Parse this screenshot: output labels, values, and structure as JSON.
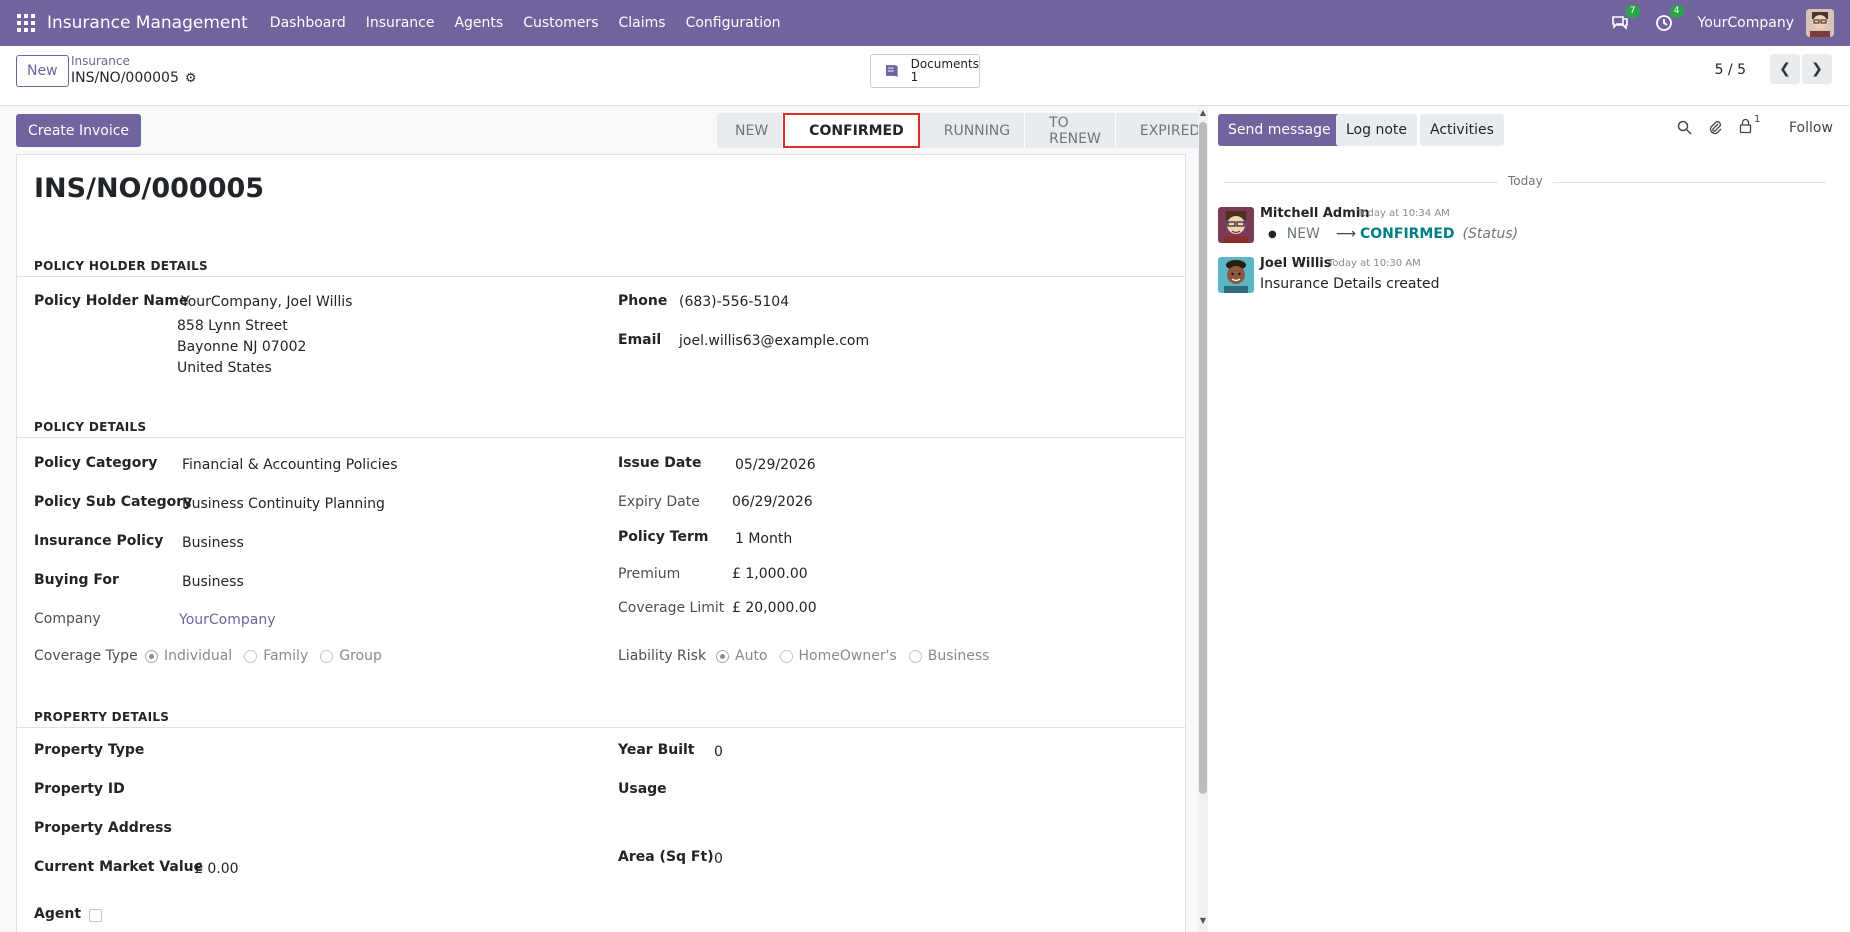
{
  "navbar": {
    "app_title": "Insurance Management",
    "menu": [
      "Dashboard",
      "Insurance",
      "Agents",
      "Customers",
      "Claims",
      "Configuration"
    ],
    "messages_count": "7",
    "activities_count": "4",
    "company": "YourCompany"
  },
  "control": {
    "new_label": "New",
    "breadcrumb_parent": "Insurance",
    "breadcrumb_current": "INS/NO/000005",
    "documents_label": "Documents",
    "documents_count": "1",
    "pager": "5 / 5"
  },
  "form": {
    "create_invoice_label": "Create Invoice",
    "stages": [
      "NEW",
      "CONFIRMED",
      "RUNNING",
      "TO RENEW",
      "EXPIRED"
    ],
    "active_stage": "CONFIRMED",
    "record_name": "INS/NO/000005",
    "policy_holder": {
      "section_title": "POLICY HOLDER DETAILS",
      "name_label": "Policy Holder Name",
      "name_value": "YourCompany, Joel Willis",
      "address_line1": "858 Lynn Street",
      "address_line2": "Bayonne NJ 07002",
      "address_line3": "United States",
      "phone_label": "Phone",
      "phone_value": "(683)-556-5104",
      "email_label": "Email",
      "email_value": "joel.willis63@example.com"
    },
    "policy": {
      "section_title": "POLICY DETAILS",
      "category_label": "Policy Category",
      "category_value": "Financial & Accounting Policies",
      "sub_category_label": "Policy Sub Category",
      "sub_category_value": "Business Continuity Planning",
      "insurance_policy_label": "Insurance Policy",
      "insurance_policy_value": "Business",
      "buying_for_label": "Buying For",
      "buying_for_value": "Business",
      "company_label": "Company",
      "company_value": "YourCompany",
      "coverage_type_label": "Coverage Type",
      "coverage_type_options": [
        "Individual",
        "Family",
        "Group"
      ],
      "coverage_type_selected": "Individual",
      "issue_date_label": "Issue Date",
      "issue_date_value": "05/29/2026",
      "expiry_date_label": "Expiry Date",
      "expiry_date_value": "06/29/2026",
      "policy_term_label": "Policy Term",
      "policy_term_value": "1 Month",
      "premium_label": "Premium",
      "premium_value": "£ 1,000.00",
      "coverage_limit_label": "Coverage Limit",
      "coverage_limit_value": "£ 20,000.00",
      "liability_risk_label": "Liability Risk",
      "liability_risk_options": [
        "Auto",
        "HomeOwner's",
        "Business"
      ],
      "liability_risk_selected": "Auto"
    },
    "property": {
      "section_title": "PROPERTY DETAILS",
      "type_label": "Property Type",
      "id_label": "Property ID",
      "address_label": "Property Address",
      "market_value_label": "Current Market Value",
      "market_value_value": "£ 0.00",
      "agent_label": "Agent",
      "year_built_label": "Year Built",
      "year_built_value": "0",
      "usage_label": "Usage",
      "area_label": "Area (Sq Ft)",
      "area_value": "0"
    }
  },
  "chatter": {
    "send_message_label": "Send message",
    "log_note_label": "Log note",
    "activities_label": "Activities",
    "followers_count": "1",
    "follow_label": "Follow",
    "date_separator": "Today",
    "messages": [
      {
        "author": "Mitchell Admin",
        "time": "Today at 10:34 AM",
        "tracking_old": "NEW",
        "tracking_new": "CONFIRMED",
        "tracking_field": "(Status)"
      },
      {
        "author": "Joel Willis",
        "time": "Today at 10:30 AM",
        "body": "Insurance Details created"
      }
    ]
  },
  "colors": {
    "brand": "#71639e",
    "highlight": "#e02b27",
    "tracking_new": "#017e84",
    "badge": "#28a745"
  }
}
